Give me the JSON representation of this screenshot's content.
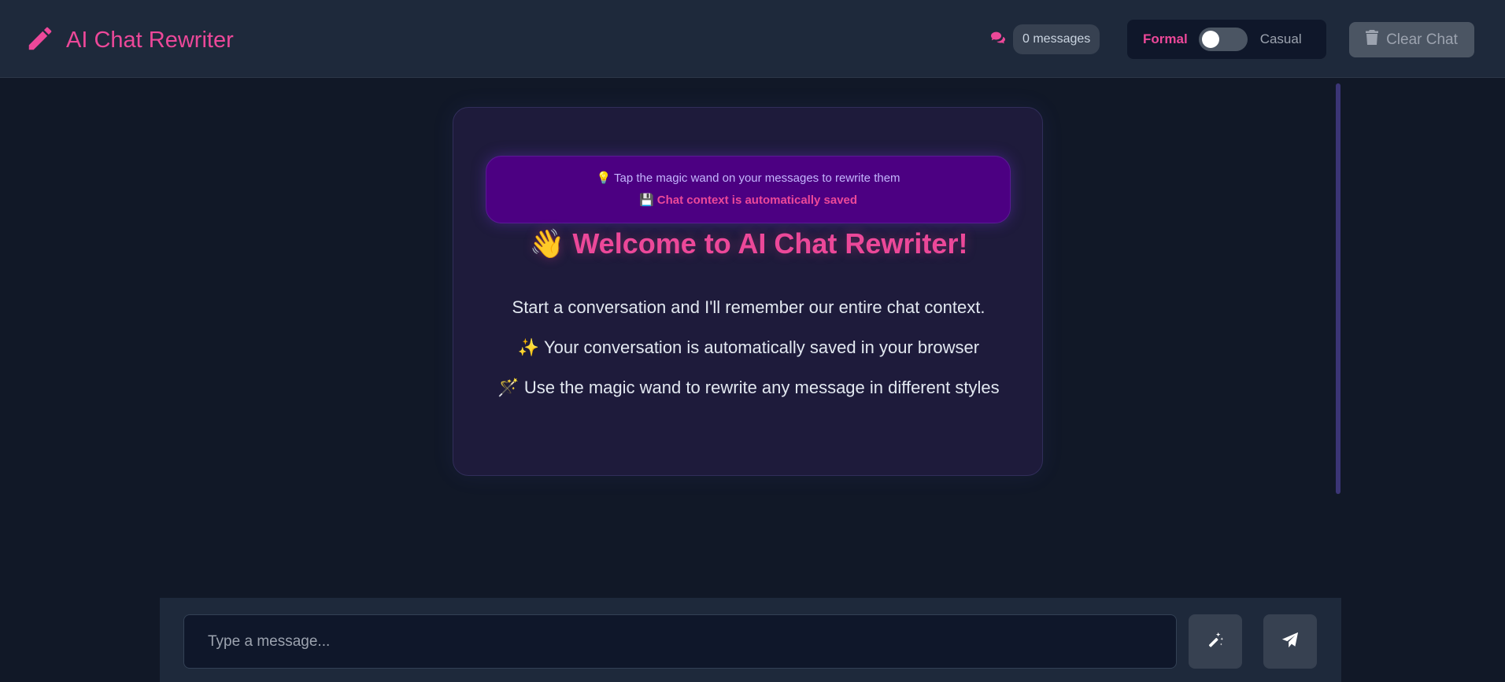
{
  "header": {
    "title": "AI Chat Rewriter",
    "logo_icon": "pencil-icon",
    "message_count": "0 messages",
    "message_icon": "comments-icon",
    "style_toggle": {
      "left_label": "Formal",
      "right_label": "Casual",
      "active": "Formal"
    },
    "clear_button": "Clear Chat",
    "clear_icon": "trash-icon"
  },
  "welcome": {
    "notice_line1": "💡 Tap the magic wand on your messages to rewrite them",
    "notice_line2": "💾 Chat context is automatically saved",
    "title": "👋 Welcome to AI Chat Rewriter!",
    "line1": "Start a conversation and I'll remember our entire chat context.",
    "line2": "✨ Your conversation is automatically saved in your browser",
    "line3": "🪄 Use the magic wand to rewrite any message in different styles"
  },
  "composer": {
    "placeholder": "Type a message...",
    "value": "",
    "wand_icon": "magic-wand-icon",
    "send_icon": "paper-plane-icon"
  },
  "colors": {
    "accent": "#ec4899",
    "background": "#111827",
    "header": "#1e293b",
    "card": "#1e1b3b",
    "notice": "#4c0082"
  }
}
